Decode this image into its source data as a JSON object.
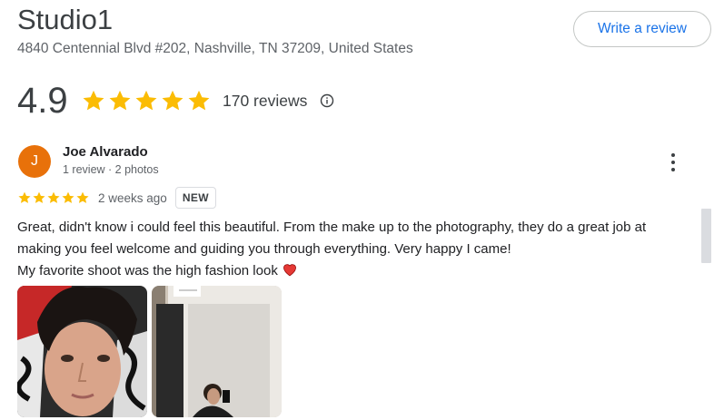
{
  "place": {
    "name": "Studio1",
    "address": "4840 Centennial Blvd #202, Nashville, TN 37209, United States"
  },
  "header": {
    "write_review_label": "Write a review"
  },
  "rating": {
    "value": "4.9",
    "stars": 5,
    "count_label": "170 reviews",
    "info_icon": "info-icon",
    "star_color": "#fbbc04"
  },
  "review": {
    "avatar_letter": "J",
    "avatar_color": "#e8710a",
    "reviewer_name": "Joe Alvarado",
    "reviewer_meta": "1 review · 2 photos",
    "stars": 5,
    "time": "2 weeks ago",
    "badge": "NEW",
    "text_lines": [
      "Great, didn't know i could feel this beautiful. From the make up to the photography, they do a great job at",
      "making you feel welcome and guiding you through everything. Very happy I came!",
      "My favorite shoot was the high fashion look"
    ],
    "emoji_icon": "red-heart-icon",
    "more_icon": "more-vert-icon",
    "photos": [
      {
        "icon": "selfie-photo"
      },
      {
        "icon": "mirror-selfie-photo"
      }
    ]
  }
}
